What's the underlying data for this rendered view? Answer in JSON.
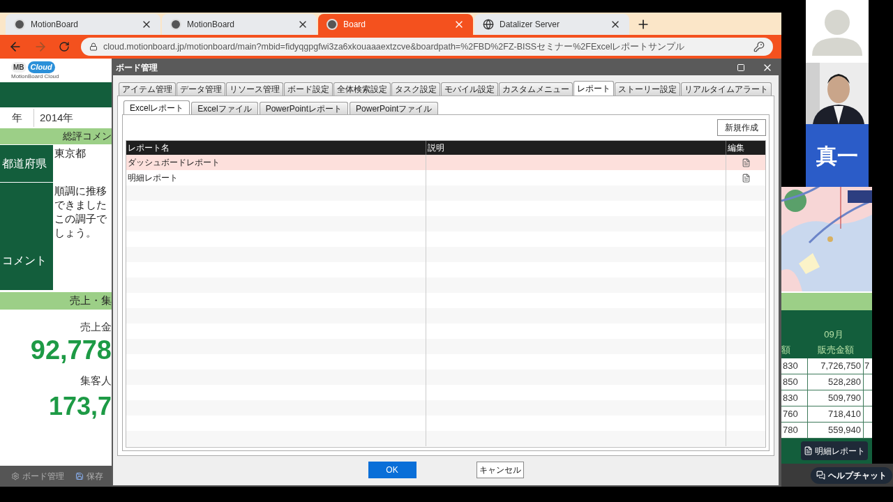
{
  "browser": {
    "tabs": [
      {
        "title": "MotionBoard",
        "selected": false
      },
      {
        "title": "MotionBoard",
        "selected": false
      },
      {
        "title": "Board",
        "selected": true
      },
      {
        "title": "Datalizer Server",
        "selected": false
      }
    ],
    "forward_disabled": true,
    "url": "cloud.motionboard.jp/motionboard/main?mbid=fidyqgpgfwi3za6xkouaaaextzcve&boardpath=%2FBD%2FZ-BISSセミナー%2FExcelレポートサンプル"
  },
  "board_left": {
    "logo": {
      "mark": "MB",
      "word": "Cloud",
      "caption": "MotionBoard Cloud"
    },
    "year_label": "年",
    "year_value": "2014年",
    "comment_header": "総評コメン",
    "rows": [
      {
        "label": "都道府県",
        "lines": [
          "東京都"
        ]
      },
      {
        "label": "コメント",
        "lines": [
          "順調に推移",
          "できました",
          "この調子で",
          "しょう。"
        ]
      }
    ],
    "sales_header": "売上・集",
    "kpis": [
      {
        "label": "売上金",
        "value": "92,778"
      },
      {
        "label": "集客人",
        "value": "173,7"
      }
    ],
    "toolbar": [
      "ボード管理",
      "保存"
    ]
  },
  "dialog": {
    "title": "ボード管理",
    "tabs": [
      {
        "label": "アイテム管理",
        "selected": false
      },
      {
        "label": "データ管理",
        "selected": false
      },
      {
        "label": "リソース管理",
        "selected": false
      },
      {
        "label": "ボード設定",
        "selected": false
      },
      {
        "label": "全体検索設定",
        "selected": false
      },
      {
        "label": "タスク設定",
        "selected": false
      },
      {
        "label": "モバイル設定",
        "selected": false
      },
      {
        "label": "カスタムメニュー",
        "selected": false
      },
      {
        "label": "レポート",
        "selected": true
      },
      {
        "label": "ストーリー設定",
        "selected": false
      },
      {
        "label": "リアルタイムアラート",
        "selected": false
      }
    ],
    "subtabs": [
      {
        "label": "Excelレポート",
        "selected": true
      },
      {
        "label": "Excelファイル",
        "selected": false
      },
      {
        "label": "PowerPointレポート",
        "selected": false
      },
      {
        "label": "PowerPointファイル",
        "selected": false
      }
    ],
    "new_button": "新規作成",
    "table": {
      "columns": [
        "レポート名",
        "説明",
        "編集"
      ],
      "rows": [
        {
          "name": "ダッシュボードレポート",
          "selected": true
        },
        {
          "name": "明細レポート",
          "selected": false
        }
      ]
    },
    "ok": "OK",
    "cancel": "キャンセル"
  },
  "video": {
    "tiles": [
      {
        "kind": "avatar"
      },
      {
        "kind": "camera"
      },
      {
        "kind": "name",
        "text": "真一"
      }
    ]
  },
  "board_right": {
    "table": {
      "month": "09月",
      "columns": [
        "額",
        "販売金額"
      ],
      "rows": [
        [
          "830",
          "7,726,750",
          "7"
        ],
        [
          "850",
          "528,280"
        ],
        [
          "830",
          "509,790"
        ],
        [
          "760",
          "718,410"
        ],
        [
          "780",
          "559,940"
        ]
      ]
    },
    "report_button": "明細レポート",
    "help_button": "ヘルプチャット"
  }
}
